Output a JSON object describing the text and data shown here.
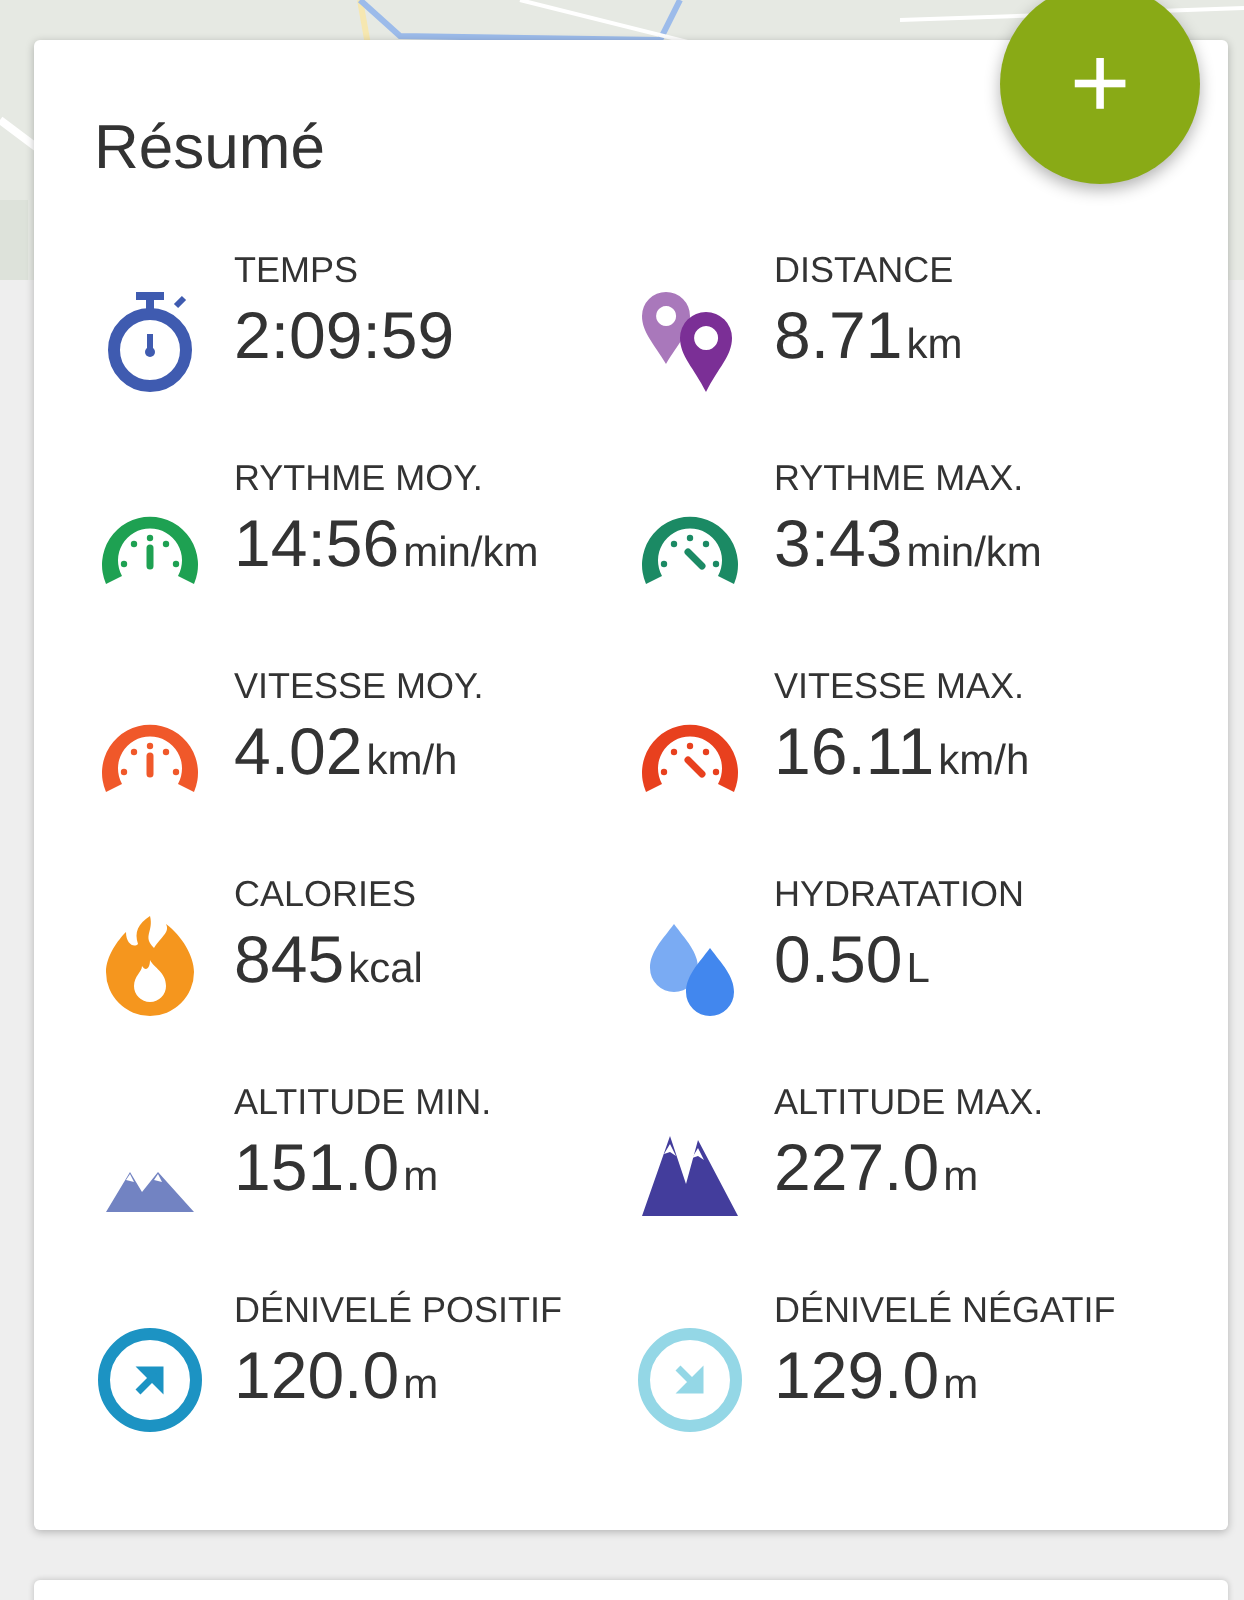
{
  "card": {
    "title": "Résumé",
    "fab": "+"
  },
  "stats": [
    {
      "label": "TEMPS",
      "value": "2:09:59",
      "kind": "stopwatch",
      "color": "#3f5bb0"
    },
    {
      "label": "DISTANCE",
      "value": "8.71",
      "unit": "km",
      "kind": "pins",
      "color": "#7b2f96"
    },
    {
      "label": "RYTHME MOY.",
      "value": "14:56",
      "unit": "min/km",
      "kind": "gauge",
      "color": "#1ea152"
    },
    {
      "label": "RYTHME MAX.",
      "value": "3:43",
      "unit": "min/km",
      "kind": "gaugemax",
      "color": "#1b8a64"
    },
    {
      "label": "VITESSE MOY.",
      "value": "4.02",
      "unit": "km/h",
      "kind": "gauge",
      "color": "#f0582a"
    },
    {
      "label": "VITESSE MAX.",
      "value": "16.11",
      "unit": "km/h",
      "kind": "gaugemax",
      "color": "#e8401e"
    },
    {
      "label": "CALORIES",
      "value": "845",
      "unit": "kcal",
      "kind": "flame",
      "color": "#f5961e"
    },
    {
      "label": "HYDRATATION",
      "value": "0.50",
      "unit": "L",
      "kind": "drops",
      "color": "#4287ee"
    },
    {
      "label": "ALTITUDE MIN.",
      "value": "151.0",
      "unit": "m",
      "kind": "mountains",
      "color": "#7283c2"
    },
    {
      "label": "ALTITUDE MAX.",
      "value": "227.0",
      "unit": "m",
      "kind": "peaks",
      "color": "#433d9c"
    },
    {
      "label": "DÉNIVELÉ POSITIF",
      "value": "120.0",
      "unit": "m",
      "kind": "ascent",
      "color": "#1c93c3"
    },
    {
      "label": "DÉNIVELÉ NÉGATIF",
      "value": "129.0",
      "unit": "m",
      "kind": "descent",
      "color": "#94d7e6"
    }
  ]
}
